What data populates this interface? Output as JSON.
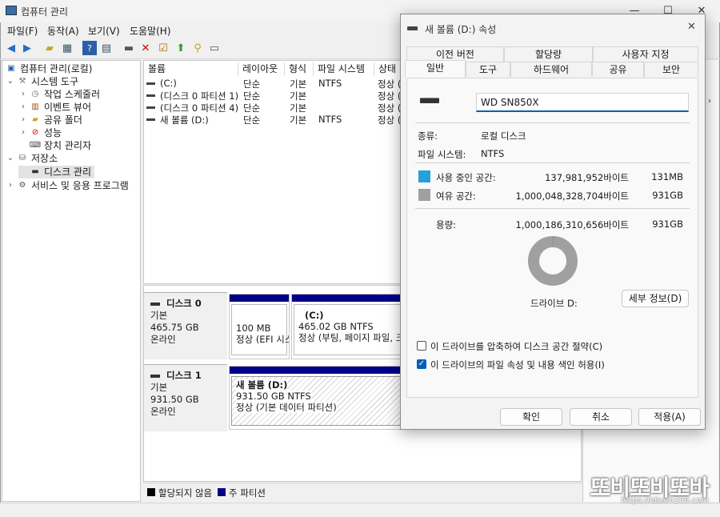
{
  "window": {
    "title": "컴퓨터 관리",
    "min": "—",
    "max": "☐",
    "close": "✕"
  },
  "menu": [
    "파일(F)",
    "동작(A)",
    "보기(V)",
    "도움말(H)"
  ],
  "tree": {
    "root": "컴퓨터 관리(로컬)",
    "system_tools": "시스템 도구",
    "task_scheduler": "작업 스케줄러",
    "event_viewer": "이벤트 뷰어",
    "shared_folders": "공유 폴더",
    "performance": "성능",
    "device_manager": "장치 관리자",
    "storage": "저장소",
    "disk_management": "디스크 관리",
    "services_apps": "서비스 및 응용 프로그램"
  },
  "volume_table": {
    "headers": [
      "볼륨",
      "레이아웃",
      "형식",
      "파일 시스템",
      "상태"
    ],
    "rows": [
      [
        "(C:)",
        "단순",
        "기본",
        "NTFS",
        "정상 ("
      ],
      [
        "(디스크 0 파티션 1)",
        "단순",
        "기본",
        "",
        "정상 ("
      ],
      [
        "(디스크 0 파티션 4)",
        "단순",
        "기본",
        "",
        "정상 ("
      ],
      [
        "새 볼륨 (D:)",
        "단순",
        "기본",
        "NTFS",
        "정상 ("
      ]
    ]
  },
  "disks": [
    {
      "name": "디스크 0",
      "type": "기본",
      "size": "465.75 GB",
      "status": "온라인",
      "parts": [
        {
          "title": "",
          "line1": "100 MB",
          "line2": "정상 (EFI 시스"
        },
        {
          "title": "(C:)",
          "line1": "465.02 GB NTFS",
          "line2": "정상 (부팅, 페이지 파일, 크"
        }
      ]
    },
    {
      "name": "디스크 1",
      "type": "기본",
      "size": "931.50 GB",
      "status": "온라인",
      "parts": [
        {
          "title": "새 볼륨  (D:)",
          "line1": "931.50 GB NTFS",
          "line2": "정상 (기본 데이터 파티션)"
        }
      ]
    }
  ],
  "legend": {
    "unallocated": "할당되지 않음",
    "primary": "주 파티션"
  },
  "dialog": {
    "title": "새 볼륨 (D:) 속성",
    "close": "✕",
    "tabs_top": [
      "이전 버전",
      "할당량",
      "사용자 지정"
    ],
    "tabs_bottom": [
      "일반",
      "도구",
      "하드웨어",
      "공유",
      "보안"
    ],
    "volume_name": "WD SN850X",
    "type_label": "종류:",
    "type_value": "로컬 디스크",
    "fs_label": "파일 시스템:",
    "fs_value": "NTFS",
    "used_label": "사용 중인 공간:",
    "used_bytes": "137,981,952바이트",
    "used_size": "131MB",
    "free_label": "여유 공간:",
    "free_bytes": "1,000,048,328,704바이트",
    "free_size": "931GB",
    "cap_label": "용량:",
    "cap_bytes": "1,000,186,310,656바이트",
    "cap_size": "931GB",
    "drive_label": "드라이브 D:",
    "details_button": "세부 정보(D)",
    "compress_label": "이 드라이브를 압축하여 디스크 공간 절약(C)",
    "index_label": "이 드라이브의 파일 속성 및 내용 색인 허용(I)",
    "compress_checked": false,
    "index_checked": true,
    "ok": "확인",
    "cancel": "취소",
    "apply": "적용(A)",
    "used_fraction": 0.000138
  },
  "colors": {
    "used": "#26a0da",
    "free": "#a0a0a0",
    "partition": "#00008a"
  },
  "watermark": {
    "text": "또비또비또바",
    "url": "https://idsam209.com"
  }
}
